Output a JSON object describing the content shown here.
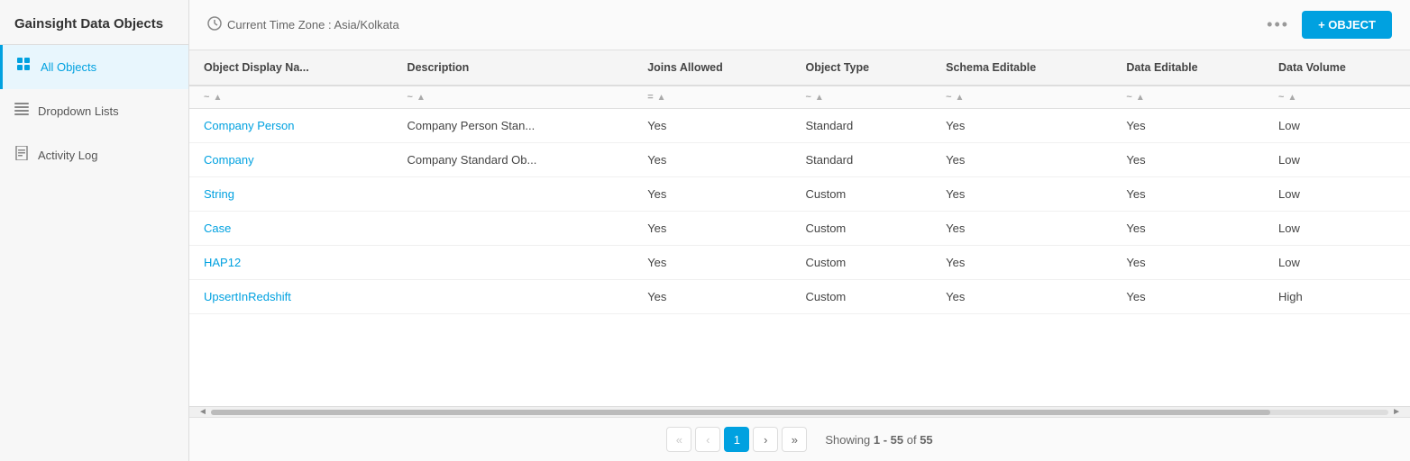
{
  "app": {
    "title": "Gainsight Data Objects"
  },
  "sidebar": {
    "items": [
      {
        "id": "all-objects",
        "label": "All Objects",
        "icon": "grid",
        "active": true
      },
      {
        "id": "dropdown-lists",
        "label": "Dropdown Lists",
        "icon": "list",
        "active": false
      },
      {
        "id": "activity-log",
        "label": "Activity Log",
        "icon": "doc",
        "active": false
      }
    ]
  },
  "toolbar": {
    "timezone_label": "Current Time Zone : Asia/Kolkata",
    "more_icon": "•••",
    "add_button_label": "+ OBJECT"
  },
  "table": {
    "columns": [
      {
        "id": "name",
        "label": "Object Display Na..."
      },
      {
        "id": "description",
        "label": "Description"
      },
      {
        "id": "joins_allowed",
        "label": "Joins Allowed"
      },
      {
        "id": "object_type",
        "label": "Object Type"
      },
      {
        "id": "schema_editable",
        "label": "Schema Editable"
      },
      {
        "id": "data_editable",
        "label": "Data Editable"
      },
      {
        "id": "data_volume",
        "label": "Data Volume"
      }
    ],
    "rows": [
      {
        "name": "Company Person",
        "description": "Company Person Stan...",
        "joins_allowed": "Yes",
        "object_type": "Standard",
        "schema_editable": "Yes",
        "data_editable": "Yes",
        "data_volume": "Low"
      },
      {
        "name": "Company",
        "description": "Company Standard Ob...",
        "joins_allowed": "Yes",
        "object_type": "Standard",
        "schema_editable": "Yes",
        "data_editable": "Yes",
        "data_volume": "Low"
      },
      {
        "name": "String",
        "description": "",
        "joins_allowed": "Yes",
        "object_type": "Custom",
        "schema_editable": "Yes",
        "data_editable": "Yes",
        "data_volume": "Low"
      },
      {
        "name": "Case",
        "description": "",
        "joins_allowed": "Yes",
        "object_type": "Custom",
        "schema_editable": "Yes",
        "data_editable": "Yes",
        "data_volume": "Low"
      },
      {
        "name": "HAP12",
        "description": "",
        "joins_allowed": "Yes",
        "object_type": "Custom",
        "schema_editable": "Yes",
        "data_editable": "Yes",
        "data_volume": "Low"
      },
      {
        "name": "UpsertInRedshift",
        "description": "",
        "joins_allowed": "Yes",
        "object_type": "Custom",
        "schema_editable": "Yes",
        "data_editable": "Yes",
        "data_volume": "High"
      }
    ]
  },
  "pagination": {
    "first_icon": "«",
    "prev_icon": "‹",
    "next_icon": "›",
    "last_icon": "»",
    "current_page": 1,
    "showing_label": "Showing",
    "range_start": 1,
    "range_end": 55,
    "total": 55
  }
}
